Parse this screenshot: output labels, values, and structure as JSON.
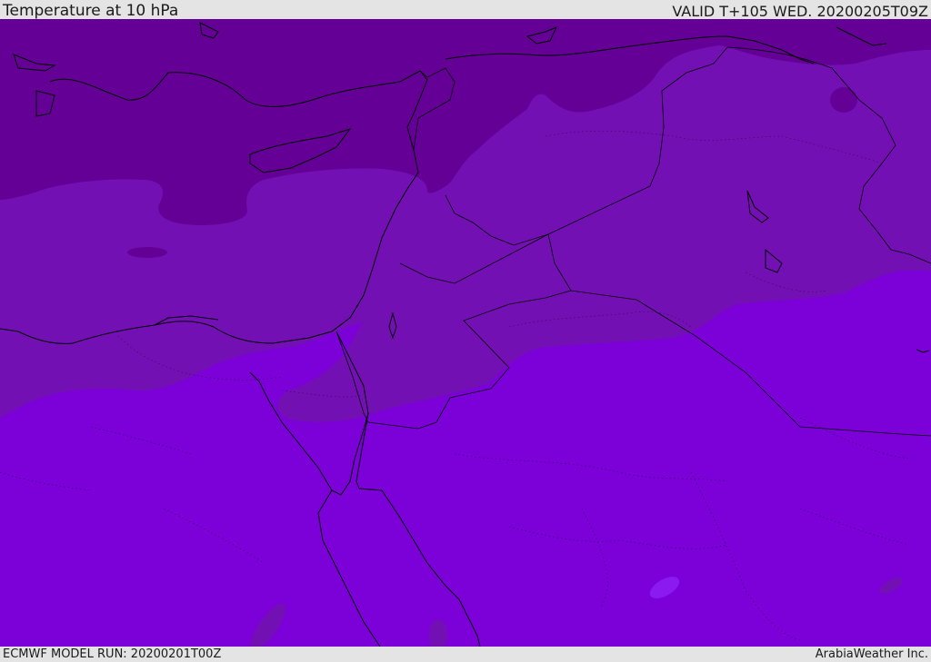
{
  "header": {
    "title": "Temperature at 10 hPa",
    "valid_time": "VALID T+105 WED. 20200205T09Z"
  },
  "footer": {
    "model_run": "ECMWF MODEL RUN: 20200201T00Z",
    "credit": "ArabiaWeather Inc."
  },
  "map": {
    "region": "Eastern Mediterranean and Middle East",
    "field": "Temperature",
    "level": "10 hPa",
    "colors": {
      "coldest_band": "#640096",
      "middle_band": "#7310b4",
      "warm_band": "#7c00d8",
      "warm_spot": "#8a1af0",
      "coastline": "#000000"
    }
  }
}
